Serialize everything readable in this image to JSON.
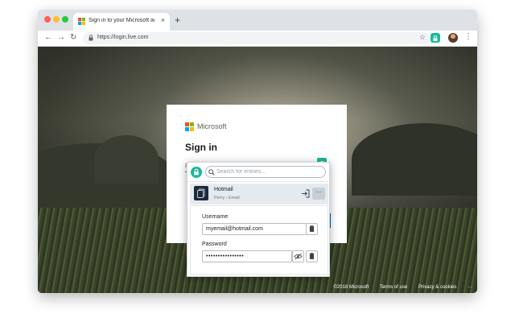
{
  "browser": {
    "tab_title": "Sign in to your Microsoft account",
    "tab_close": "×",
    "new_tab": "+",
    "url": "https://login.live.com",
    "nav": {
      "back": "←",
      "forward": "→",
      "reload": "↻"
    },
    "star": "☆",
    "menu": "⋮"
  },
  "signin": {
    "brand": "Microsoft",
    "title": "Sign in",
    "email_placeholder": "Email, phone, or Skype"
  },
  "password_manager": {
    "search_placeholder": "Search for entries...",
    "entry": {
      "title": "Hotmail",
      "subtitle": "Perry › Email",
      "more": "···"
    },
    "username_label": "Username",
    "username_value": "myemail@hotmail.com",
    "password_label": "Password",
    "password_value": "••••••••••••••••"
  },
  "footer": {
    "copyright": "©2018 Microsoft",
    "terms": "Terms of use",
    "privacy": "Privacy & cookies",
    "more": "···"
  },
  "colors": {
    "accent": "#1bb99a",
    "ms_red": "#f25022",
    "ms_green": "#7fba00",
    "ms_blue": "#00a4ef",
    "ms_yellow": "#ffb900"
  }
}
